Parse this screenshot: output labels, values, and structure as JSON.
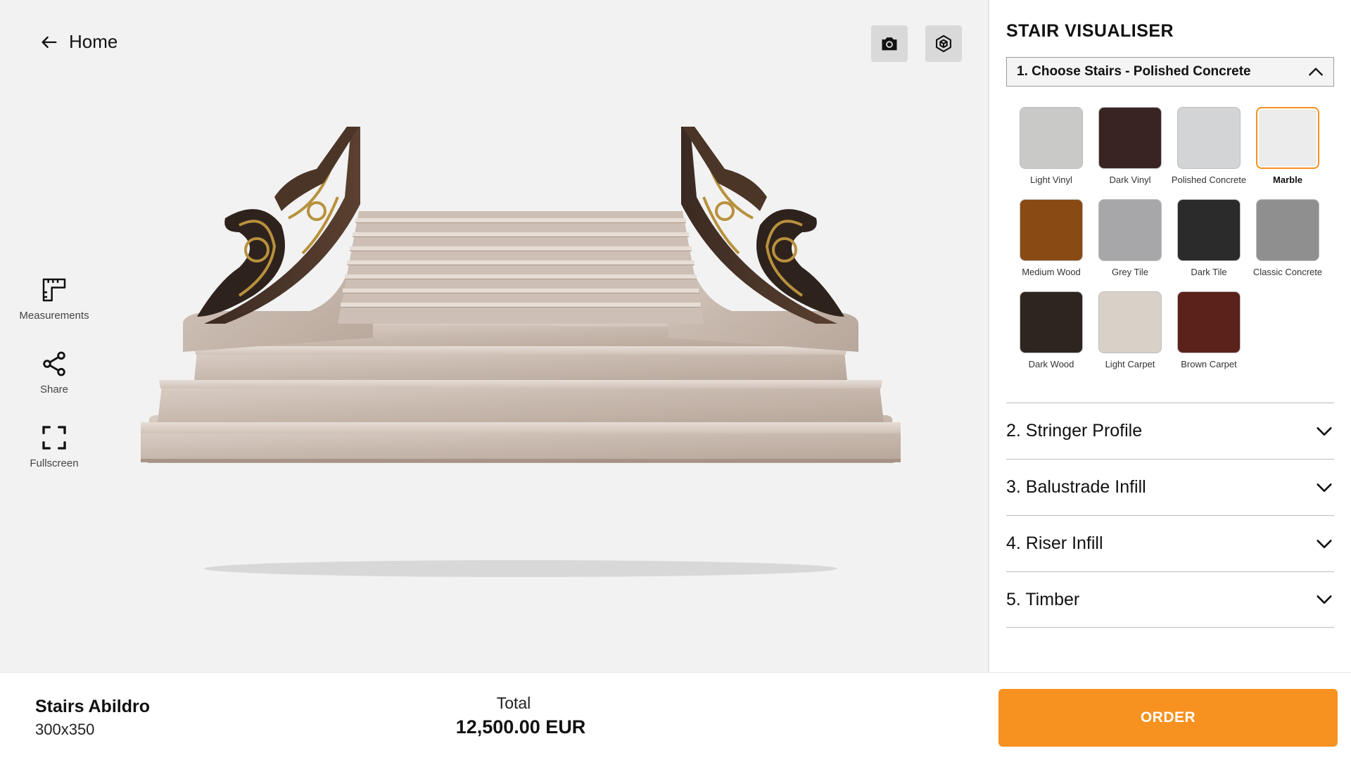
{
  "nav": {
    "home_label": "Home"
  },
  "toolbar": {
    "camera_icon": "camera-icon",
    "ar_icon": "ar-cube-icon"
  },
  "side_tools": [
    {
      "label": "Measurements",
      "icon": "ruler-icon"
    },
    {
      "label": "Share",
      "icon": "share-icon"
    },
    {
      "label": "Fullscreen",
      "icon": "fullscreen-icon"
    }
  ],
  "panel": {
    "title": "STAIR VISUALISER",
    "dropdown_label": "1. Choose Stairs - Polished Concrete",
    "materials": [
      {
        "name": "Light Vinyl",
        "color": "#c9cac8",
        "selected": false
      },
      {
        "name": "Dark Vinyl",
        "color": "#3a2422",
        "selected": false
      },
      {
        "name": "Polished Concrete",
        "color": "#d3d4d6",
        "selected": false
      },
      {
        "name": "Marble",
        "color": "#ececec",
        "selected": true
      },
      {
        "name": "Medium Wood",
        "color": "#8a4a14",
        "selected": false
      },
      {
        "name": "Grey Tile",
        "color": "#a7a7a9",
        "selected": false
      },
      {
        "name": "Dark Tile",
        "color": "#2b2b2b",
        "selected": false
      },
      {
        "name": "Classic Concrete",
        "color": "#8f8f8f",
        "selected": false
      },
      {
        "name": "Dark Wood",
        "color": "#2e2520",
        "selected": false
      },
      {
        "name": "Light Carpet",
        "color": "#d8d1c8",
        "selected": false
      },
      {
        "name": "Brown Carpet",
        "color": "#5a221a",
        "selected": false
      }
    ],
    "sections": [
      {
        "label": "2. Stringer Profile"
      },
      {
        "label": "3. Balustrade Infill"
      },
      {
        "label": "4. Riser Infill"
      },
      {
        "label": "5. Timber"
      }
    ]
  },
  "footer": {
    "product_name": "Stairs Abildro",
    "product_size": "300x350",
    "total_label": "Total",
    "total_value": "12,500.00 EUR",
    "order_label": "ORDER"
  },
  "colors": {
    "accent": "#f7911f",
    "panel_bg": "#ffffff",
    "viewport_bg": "#f2f2f2"
  }
}
